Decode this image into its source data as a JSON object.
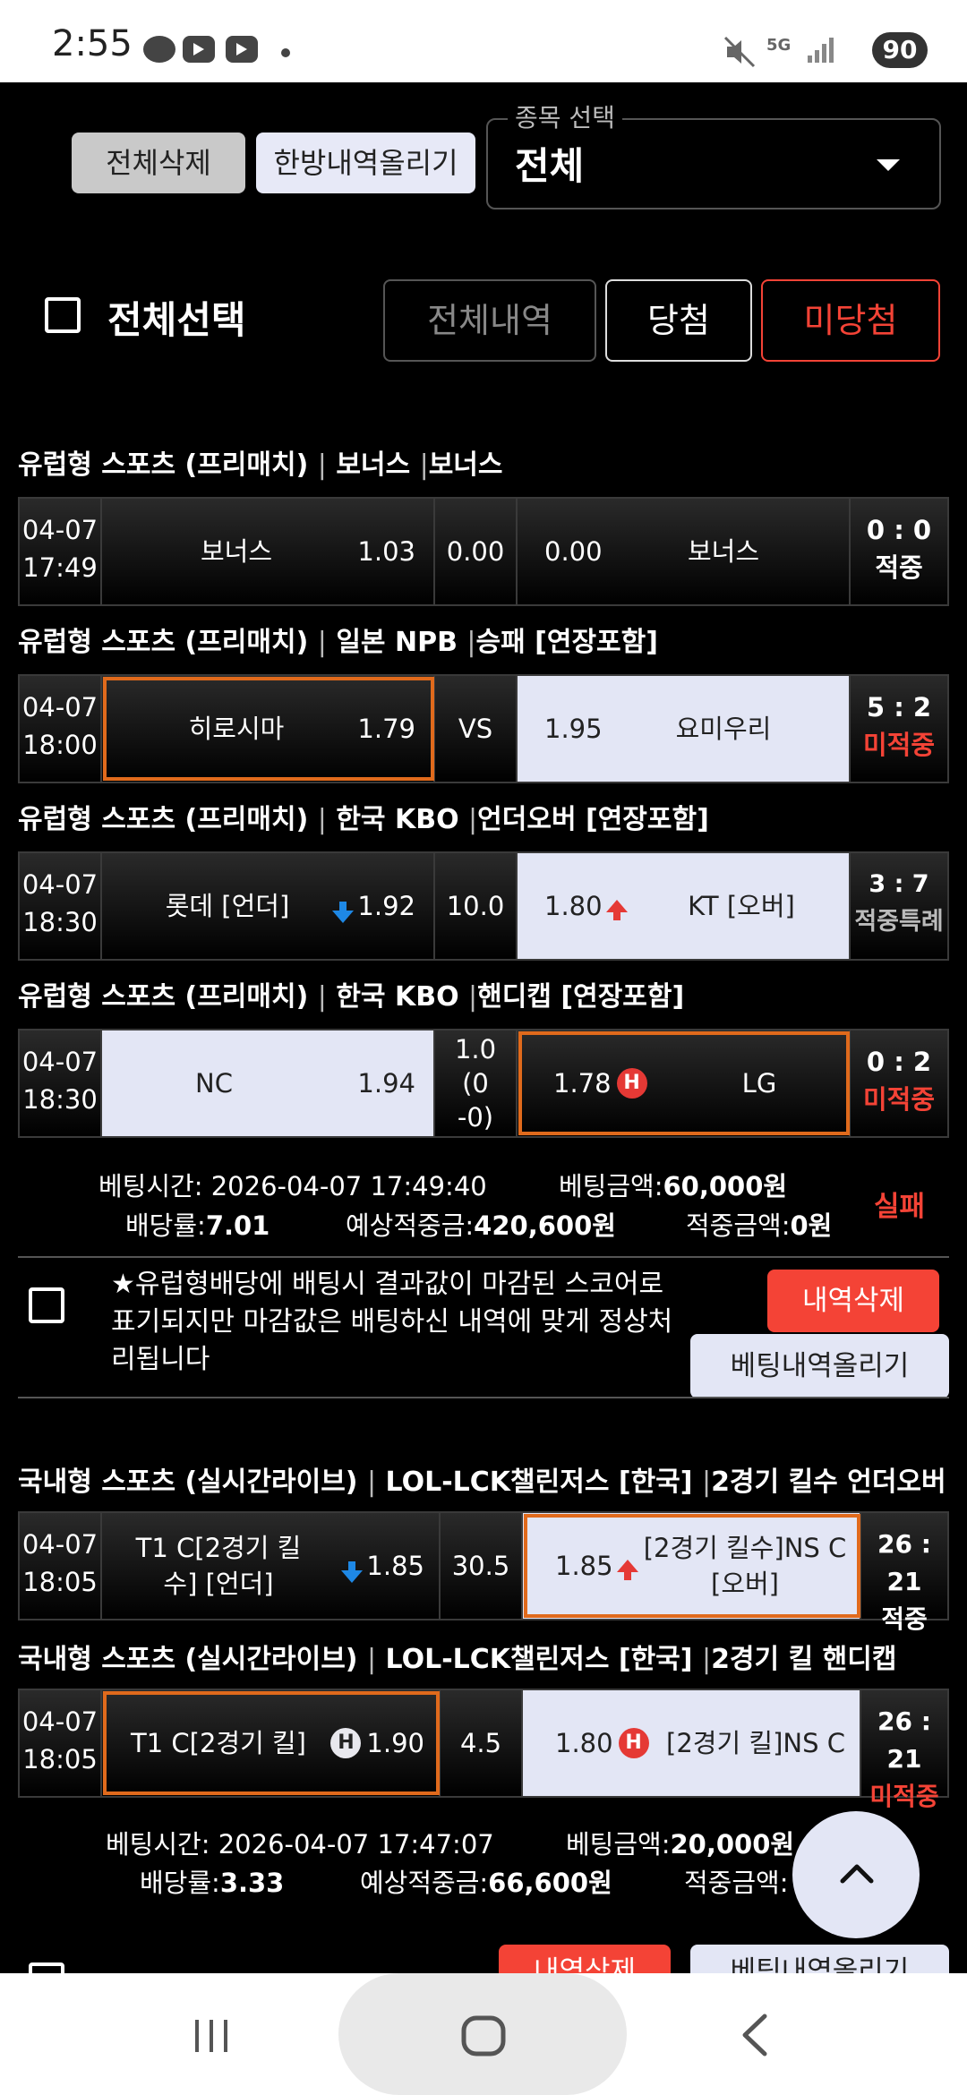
{
  "status_bar": {
    "time": "2:55",
    "battery": "90",
    "network": "5G"
  },
  "toolbar": {
    "delete_all": "전체삭제",
    "upload_history": "한방내역올리기",
    "sport_select_label": "종목 선택",
    "sport_select_value": "전체"
  },
  "filters": {
    "select_all": "전체선택",
    "all": "전체내역",
    "win": "당첨",
    "lose": "미당첨"
  },
  "bet1": {
    "games": [
      {
        "header": [
          "유럽형 스포츠 (프리매치)",
          "보너스",
          "보너스"
        ],
        "date": "04-07",
        "time": "17:49",
        "home": "보너스",
        "home_odd": "1.03",
        "mid": "0.00",
        "away_odd": "0.00",
        "away": "보너스",
        "score": "0 : 0",
        "status": "적중"
      },
      {
        "header": [
          "유럽형 스포츠 (프리매치)",
          "일본 NPB",
          "승패 [연장포함]"
        ],
        "date": "04-07",
        "time": "18:00",
        "home": "히로시마",
        "home_odd": "1.79",
        "mid": "VS",
        "away_odd": "1.95",
        "away": "요미우리",
        "score": "5 : 2",
        "status": "미적중"
      },
      {
        "header": [
          "유럽형 스포츠 (프리매치)",
          "한국 KBO",
          "언더오버 [연장포함]"
        ],
        "date": "04-07",
        "time": "18:30",
        "home": "롯데 [언더]",
        "home_odd": "1.92",
        "mid": "10.0",
        "away_odd": "1.80",
        "away": "KT [오버]",
        "score": "3 : 7",
        "status": "적중특례"
      },
      {
        "header": [
          "유럽형 스포츠 (프리매치)",
          "한국 KBO",
          "핸디캡 [연장포함]"
        ],
        "date": "04-07",
        "time": "18:30",
        "home": "NC",
        "home_odd": "1.94",
        "mid": "1.0 (0 -0)",
        "away_odd": "1.78",
        "away": "LG",
        "score": "0 : 2",
        "status": "미적중"
      }
    ],
    "bet_time_label": "베팅시간: ",
    "bet_time": "2026-04-07 17:49:40",
    "amount_label": "베팅금액:",
    "amount": "60,000원",
    "rate_label": "배당률:",
    "rate": "7.01",
    "expected_label": "예상적중금:",
    "expected": "420,600원",
    "win_label": "적중금액:",
    "win": "0원",
    "result": "실패",
    "notice": "★유럽형배당에 배팅시 결과값이 마감된 스코어로 표기되지만 마감값은 배팅하신 내역에 맞게 정상처리됩니다",
    "delete_btn": "내역삭제",
    "upload_btn": "베팅내역올리기"
  },
  "bet2": {
    "games": [
      {
        "header": [
          "국내형 스포츠 (실시간라이브)",
          "LOL-LCK챌린저스 [한국]",
          "2경기 킬수 언더오버"
        ],
        "date": "04-07",
        "time": "18:05",
        "home": "T1 C[2경기 킬수] [언더]",
        "home_odd": "1.85",
        "mid": "30.5",
        "away_odd": "1.85",
        "away": "[2경기 킬수]NS C [오버]",
        "score": "26 : 21",
        "status": "적중"
      },
      {
        "header": [
          "국내형 스포츠 (실시간라이브)",
          "LOL-LCK챌린저스 [한국]",
          "2경기 킬 핸디캡"
        ],
        "date": "04-07",
        "time": "18:05",
        "home": "T1 C[2경기 킬]",
        "home_odd": "1.90",
        "mid": "4.5",
        "away_odd": "1.80",
        "away": "[2경기 킬]NS C",
        "score": "26 : 21",
        "status": "미적중"
      }
    ],
    "bet_time_label": "베팅시간: ",
    "bet_time": "2026-04-07 17:47:07",
    "amount_label": "베팅금액:",
    "amount": "20,000원",
    "rate_label": "배당률:",
    "rate": "3.33",
    "expected_label": "예상적중금:",
    "expected": "66,600원",
    "win_label": "적중금액:",
    "delete_btn": "내역삭제",
    "upload_btn": "베팅내역올리기"
  },
  "colors": {
    "accent_red": "#f44336",
    "selected_bg": "#e3e6f5",
    "highlight_border": "#e06a1c"
  }
}
